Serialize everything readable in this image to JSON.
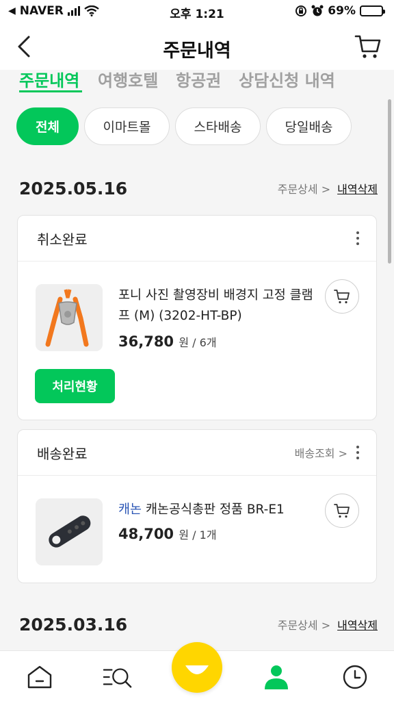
{
  "status_bar": {
    "carrier": "NAVER",
    "time": "오후 1:21",
    "battery": "69%",
    "battery_level": 0.69
  },
  "header": {
    "title": "주문내역",
    "back_icon": "chevron-left-icon",
    "cart_icon": "cart-icon"
  },
  "tabs": [
    {
      "label": "주문내역",
      "active": true
    },
    {
      "label": "여행호텔",
      "active": false
    },
    {
      "label": "항공권",
      "active": false
    },
    {
      "label": "상담신청 내역",
      "active": false
    }
  ],
  "filters": [
    {
      "label": "전체",
      "active": true
    },
    {
      "label": "이마트몰",
      "active": false
    },
    {
      "label": "스타배송",
      "active": false
    },
    {
      "label": "당일배송",
      "active": false
    }
  ],
  "orders": [
    {
      "date": "2025.05.16",
      "detail_link": "주문상세 >",
      "delete_link": "내역삭제",
      "cards": [
        {
          "status": "취소완료",
          "product_name": "포니 사진 촬영장비 배경지 고정 클램프 (M) (3202-HT-BP)",
          "price": "36,780",
          "price_unit": "원 / 6개",
          "action_button": "처리현황"
        },
        {
          "status": "배송완료",
          "tracking_link": "배송조회 >",
          "brand": "캐논",
          "product_name": "캐논공식총판 정품 BR-E1",
          "price": "48,700",
          "price_unit": "원 / 1개"
        }
      ]
    },
    {
      "date": "2025.03.16",
      "detail_link": "주문상세 >",
      "delete_link": "내역삭제"
    }
  ],
  "bottom_nav": [
    {
      "icon": "home-icon"
    },
    {
      "icon": "menu-search-icon"
    },
    {
      "icon": "smile-icon"
    },
    {
      "icon": "person-icon"
    },
    {
      "icon": "clock-icon"
    }
  ],
  "colors": {
    "accent": "#03c75a",
    "brand_link": "#2a55b5",
    "smile": "#ffd600"
  }
}
